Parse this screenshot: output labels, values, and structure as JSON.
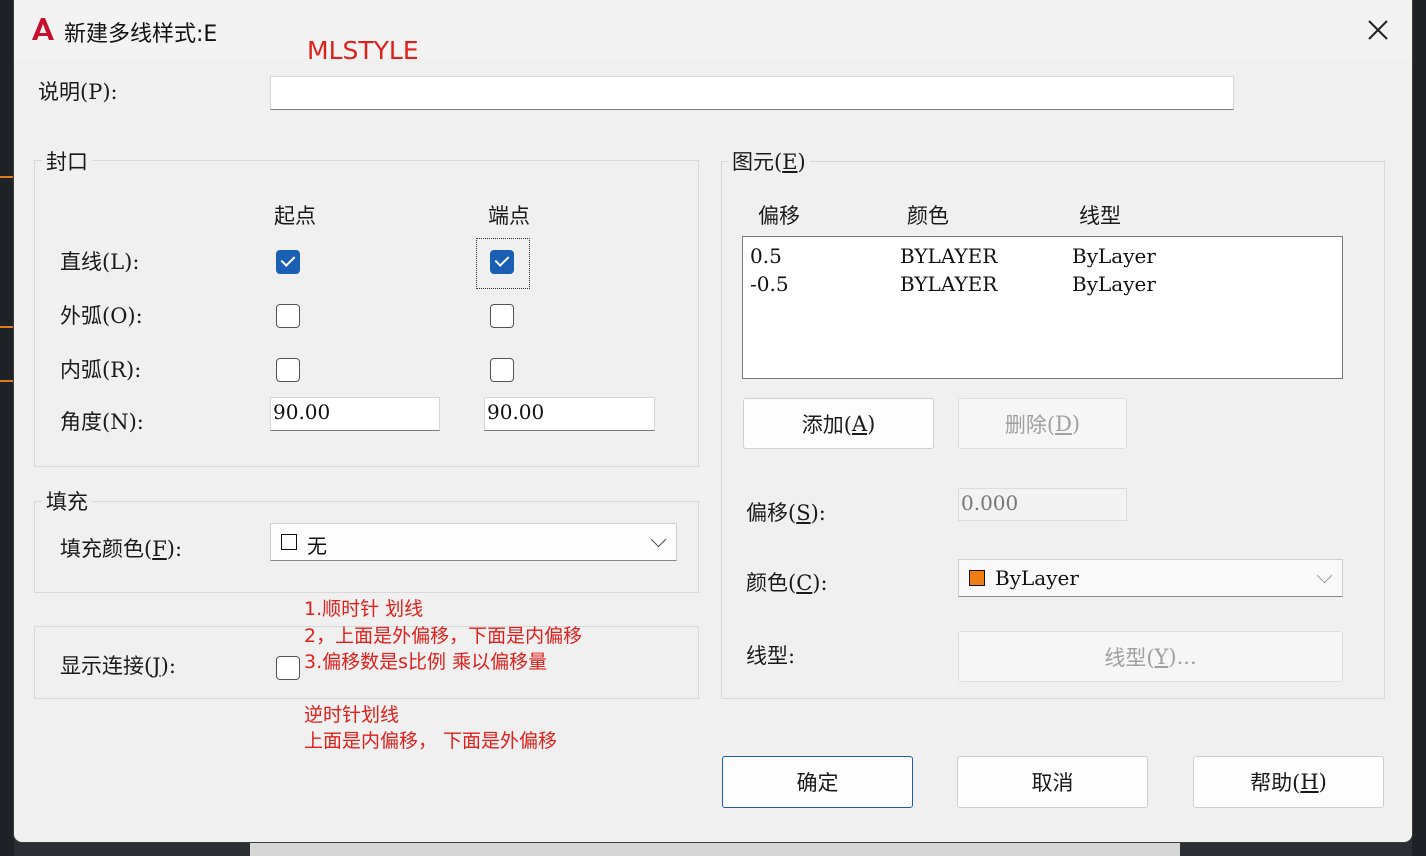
{
  "window": {
    "title": "新建多线样式:E",
    "annotation_title": "MLSTYLE"
  },
  "description": {
    "label": "说明(P):",
    "value": ""
  },
  "caps": {
    "group_title": "封口",
    "col_start": "起点",
    "col_end": "端点",
    "rows": [
      {
        "label": "直线(L):",
        "start_checked": true,
        "end_checked": true
      },
      {
        "label": "外弧(O):",
        "start_checked": false,
        "end_checked": false
      },
      {
        "label": "内弧(R):",
        "start_checked": false,
        "end_checked": false
      }
    ],
    "angle_label": "角度(N):",
    "angle_start": "90.00",
    "angle_end": "90.00"
  },
  "fill": {
    "group_title": "填充",
    "color_label_pre": "填充颜色(",
    "color_label_key": "F",
    "color_label_post": "):",
    "color_value": "无",
    "swatch_color": "#ffffff"
  },
  "joints": {
    "label_pre": "显示连接(",
    "label_key": "J",
    "label_post": "):",
    "checked": false
  },
  "elements": {
    "group_title_pre": "图元(",
    "group_title_key": "E",
    "group_title_post": ")",
    "headers": [
      "偏移",
      "颜色",
      "线型"
    ],
    "rows": [
      {
        "offset": "0.5",
        "color": "BYLAYER",
        "linetype": "ByLayer"
      },
      {
        "offset": "-0.5",
        "color": "BYLAYER",
        "linetype": "ByLayer"
      }
    ],
    "add_pre": "添加(",
    "add_key": "A",
    "add_post": ")",
    "delete_pre": "删除(",
    "delete_key": "D",
    "delete_post": ")",
    "offset_pre": "偏移(",
    "offset_key": "S",
    "offset_post": "):",
    "offset_value": "0.000",
    "color_pre": "颜色(",
    "color_key": "C",
    "color_post": "):",
    "color_value": "ByLayer",
    "color_swatch": "#f07d10",
    "linetype_label": "线型:",
    "linetype_btn_pre": "线型(",
    "linetype_btn_key": "Y",
    "linetype_btn_post": ")..."
  },
  "buttons": {
    "ok": "确定",
    "cancel": "取消",
    "help_pre": "帮助(",
    "help_key": "H",
    "help_post": ")"
  },
  "annotations": {
    "line1": "1.顺时针 划线",
    "line2": "2，上面是外偏移，下面是内偏移",
    "line3": "3.偏移数是s比例 乘以偏移量",
    "line4": "逆时针划线",
    "line5": "上面是内偏移， 下面是外偏移"
  },
  "colors": {
    "accent": "#1a5fb4",
    "annotation": "#e0201b",
    "logo": "#c8102e"
  }
}
